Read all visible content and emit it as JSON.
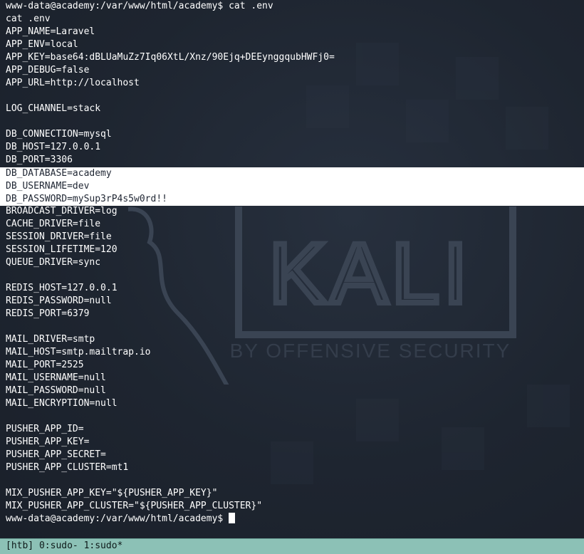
{
  "terminal": {
    "lines_top": [
      "www-data@academy:/var/www/html/academy$ cat .env",
      "cat .env",
      "APP_NAME=Laravel",
      "APP_ENV=local",
      "APP_KEY=base64:dBLUaMuZz7Iq06XtL/Xnz/90Ejq+DEEynggqubHWFj0=",
      "APP_DEBUG=false",
      "APP_URL=http://localhost",
      "",
      "LOG_CHANNEL=stack",
      "",
      "DB_CONNECTION=mysql",
      "DB_HOST=127.0.0.1",
      "DB_PORT=3306"
    ],
    "highlighted_lines": [
      "DB_DATABASE=academy",
      "DB_USERNAME=dev",
      "DB_PASSWORD=mySup3rP4s5w0rd!!"
    ],
    "lines_bottom": [
      "BROADCAST_DRIVER=log",
      "CACHE_DRIVER=file",
      "SESSION_DRIVER=file",
      "SESSION_LIFETIME=120",
      "QUEUE_DRIVER=sync",
      "",
      "REDIS_HOST=127.0.0.1",
      "REDIS_PASSWORD=null",
      "REDIS_PORT=6379",
      "",
      "MAIL_DRIVER=smtp",
      "MAIL_HOST=smtp.mailtrap.io",
      "MAIL_PORT=2525",
      "MAIL_USERNAME=null",
      "MAIL_PASSWORD=null",
      "MAIL_ENCRYPTION=null",
      "",
      "PUSHER_APP_ID=",
      "PUSHER_APP_KEY=",
      "PUSHER_APP_SECRET=",
      "PUSHER_APP_CLUSTER=mt1",
      "",
      "MIX_PUSHER_APP_KEY=\"${PUSHER_APP_KEY}\"",
      "MIX_PUSHER_APP_CLUSTER=\"${PUSHER_APP_CLUSTER}\""
    ],
    "prompt": "www-data@academy:/var/www/html/academy$ "
  },
  "watermark": {
    "logo_text": "KALI",
    "tagline": "BY OFFENSIVE SECURITY"
  },
  "statusbar": {
    "text": "[htb] 0:sudo- 1:sudo*"
  },
  "colors": {
    "background": "#1f2633",
    "text": "#ffffff",
    "highlight": "#ffffff",
    "statusbar": "#8cc1b6"
  }
}
